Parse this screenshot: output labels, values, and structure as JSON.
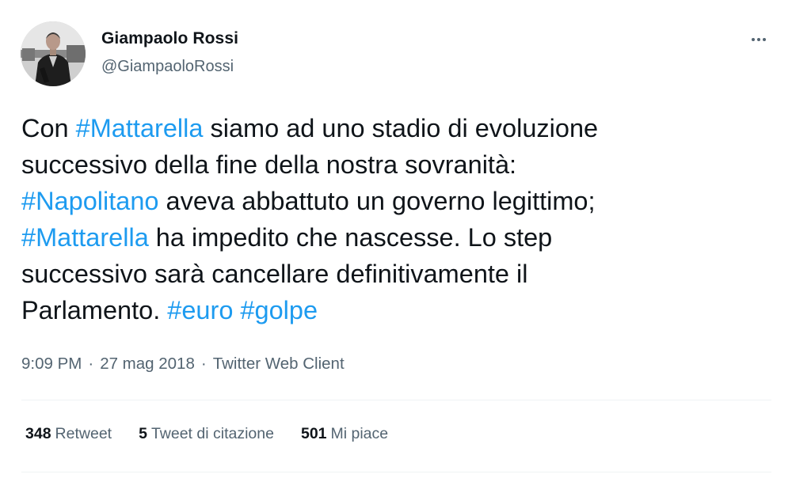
{
  "author": {
    "display_name": "Giampaolo Rossi",
    "handle": "@GiampaoloRossi"
  },
  "tweet": {
    "lines": [
      [
        {
          "text": "Con ",
          "hashtag": false
        },
        {
          "text": "#Mattarella",
          "hashtag": true
        },
        {
          "text": " siamo ad uno stadio di evoluzione",
          "hashtag": false
        }
      ],
      [
        {
          "text": "successivo della fine della nostra sovranità:",
          "hashtag": false
        }
      ],
      [
        {
          "text": "#Napolitano",
          "hashtag": true
        },
        {
          "text": " aveva abbattuto un governo legittimo;",
          "hashtag": false
        }
      ],
      [
        {
          "text": "#Mattarella",
          "hashtag": true
        },
        {
          "text": " ha impedito che nascesse. Lo step",
          "hashtag": false
        }
      ],
      [
        {
          "text": "successivo sarà cancellare definitivamente il",
          "hashtag": false
        }
      ],
      [
        {
          "text": "Parlamento. ",
          "hashtag": false
        },
        {
          "text": "#euro",
          "hashtag": true
        },
        {
          "text": " ",
          "hashtag": false
        },
        {
          "text": "#golpe",
          "hashtag": true
        }
      ]
    ]
  },
  "meta": {
    "time": "9:09 PM",
    "date": "27 mag 2018",
    "source": "Twitter Web Client",
    "separator": "·"
  },
  "stats": {
    "retweets": {
      "count": "348",
      "label": "Retweet"
    },
    "quotes": {
      "count": "5",
      "label": "Tweet di citazione"
    },
    "likes": {
      "count": "501",
      "label": "Mi piace"
    }
  },
  "colors": {
    "hashtag": "#1d9bf0",
    "secondary_text": "#536471",
    "primary_text": "#0f1419",
    "divider": "#eff3f4"
  },
  "icons": {
    "more": "more-horizontal-icon"
  }
}
